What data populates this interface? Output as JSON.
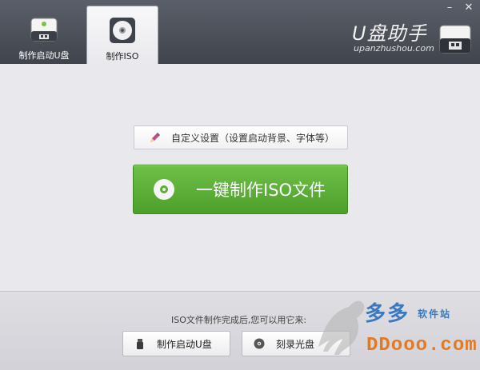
{
  "app": {
    "title": "U盘助手",
    "url": "upanzhushou.com"
  },
  "window_controls": {
    "minimize": "–",
    "close": "✕"
  },
  "tabs": [
    {
      "label": "制作启动U盘",
      "icon": "usb-drive-icon",
      "active": false
    },
    {
      "label": "制作ISO",
      "icon": "cd-disc-icon",
      "active": true
    }
  ],
  "main": {
    "settings_label": "自定义设置（设置启动背景、字体等）",
    "create_iso_label": "一键制作ISO文件"
  },
  "bottom": {
    "hint": "ISO文件制作完成后,您可以用它来:",
    "make_usb_label": "制作启动U盘",
    "burn_label": "刻录光盘"
  },
  "watermark": {
    "line1": "多多",
    "line2": "软件站",
    "line3": "DDooo.com"
  },
  "colors": {
    "titlebar": "#4a4e57",
    "accent_green": "#5caf36",
    "background": "#e9e9ed"
  }
}
